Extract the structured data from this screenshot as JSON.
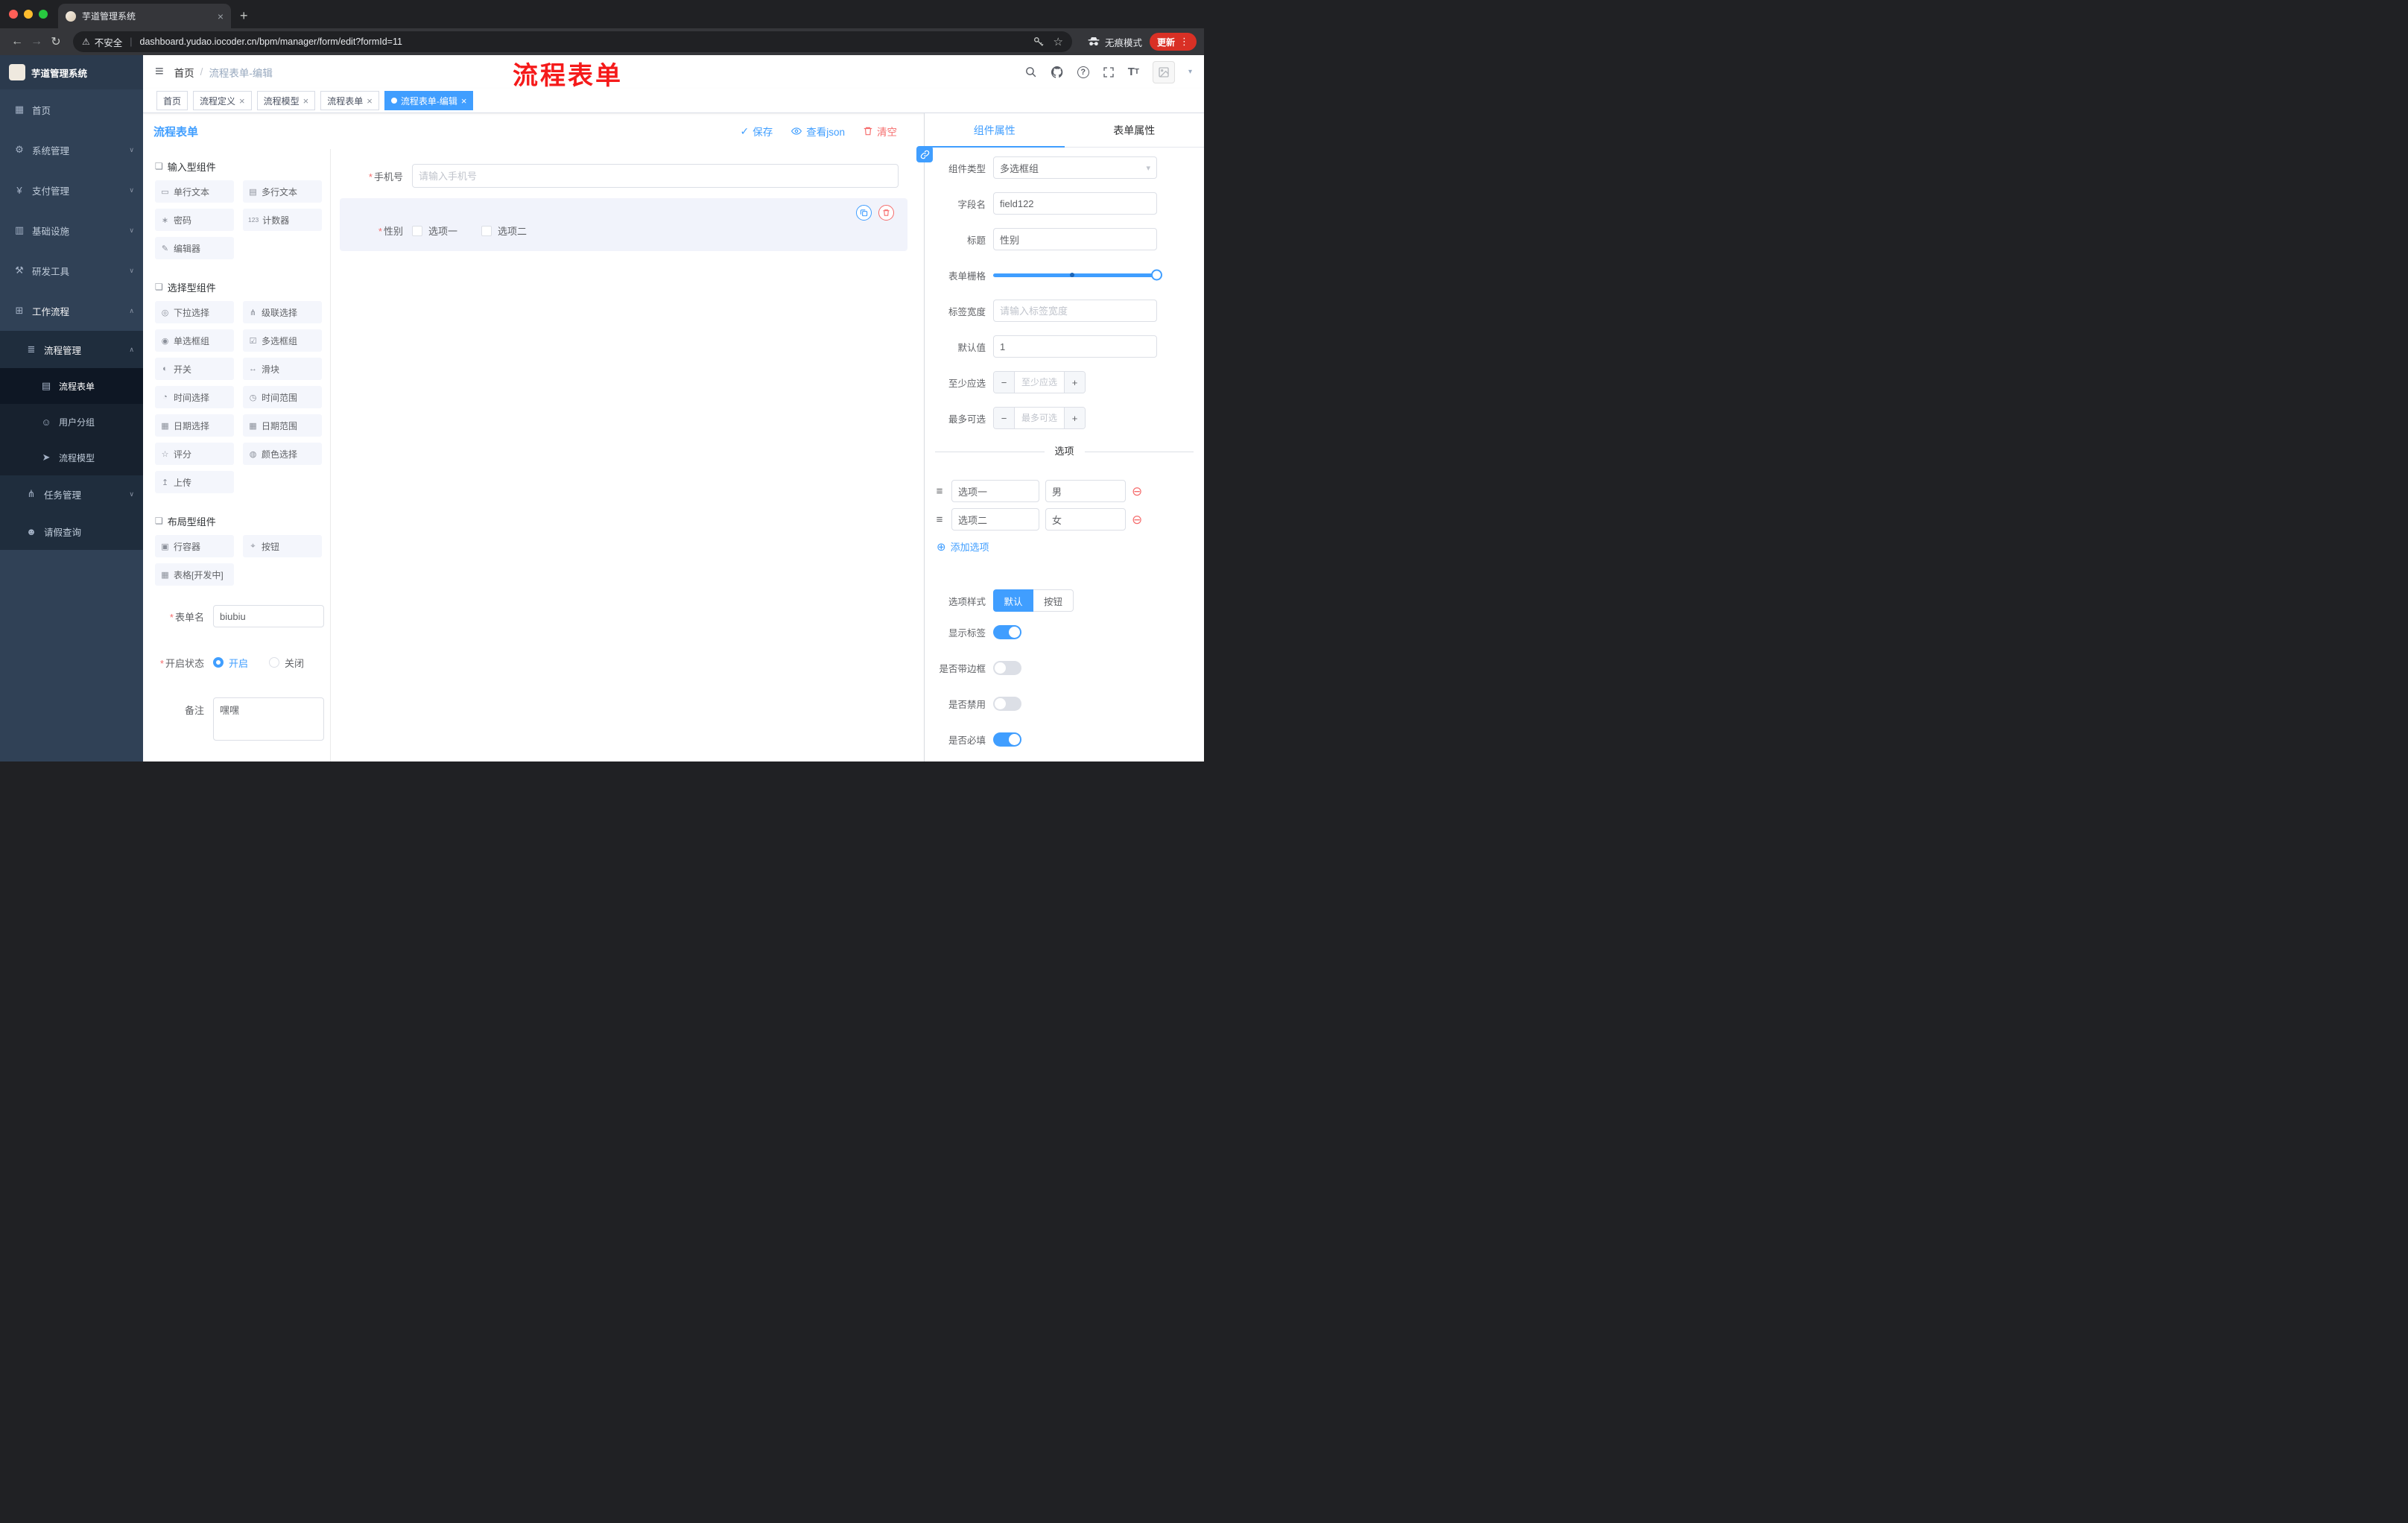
{
  "annotation": {
    "text": "流程表单"
  },
  "colors": {
    "accent": "#409eff",
    "danger": "#f56c6c",
    "sidebar": "#304156"
  },
  "browser": {
    "tab": {
      "title": "芋道管理系统"
    },
    "address": {
      "security": "不安全",
      "url": "dashboard.yudao.iocoder.cn/bpm/manager/form/edit?formId=11"
    },
    "incognito": "无痕模式",
    "update": "更新"
  },
  "sidebar": {
    "logo": "芋道管理系统",
    "menu": [
      {
        "icon": "▦",
        "label": "首页"
      },
      {
        "icon": "⚙",
        "label": "系统管理"
      },
      {
        "icon": "¥",
        "label": "支付管理"
      },
      {
        "icon": "▥",
        "label": "基础设施"
      },
      {
        "icon": "⚒",
        "label": "研发工具"
      },
      {
        "icon": "⊞",
        "label": "工作流程"
      },
      {
        "icon": "≣",
        "label": "流程管理"
      },
      {
        "icon": "▤",
        "label": "流程表单"
      },
      {
        "icon": "☺",
        "label": "用户分组"
      },
      {
        "icon": "➤",
        "label": "流程模型"
      },
      {
        "icon": "⋔",
        "label": "任务管理"
      },
      {
        "icon": "☻",
        "label": "请假查询"
      }
    ]
  },
  "header": {
    "breadcrumb": [
      "首页",
      "流程表单-编辑"
    ]
  },
  "tags": [
    {
      "label": "首页"
    },
    {
      "label": "流程定义"
    },
    {
      "label": "流程模型"
    },
    {
      "label": "流程表单"
    },
    {
      "label": "流程表单-编辑"
    }
  ],
  "designer": {
    "title": "流程表单",
    "actions": {
      "save": "保存",
      "view_json": "查看json",
      "clear": "清空"
    }
  },
  "palette": {
    "sections": [
      {
        "title": "输入型组件",
        "items": [
          {
            "g": "▭",
            "label": "单行文本"
          },
          {
            "g": "▤",
            "label": "多行文本"
          },
          {
            "g": "∗",
            "label": "密码"
          },
          {
            "g": "123",
            "label": "计数器"
          },
          {
            "g": "✎",
            "label": "编辑器"
          }
        ]
      },
      {
        "title": "选择型组件",
        "items": [
          {
            "g": "◎",
            "label": "下拉选择"
          },
          {
            "g": "⋔",
            "label": "级联选择"
          },
          {
            "g": "◉",
            "label": "单选框组"
          },
          {
            "g": "☑",
            "label": "多选框组"
          },
          {
            "g": "◐",
            "label": "开关"
          },
          {
            "g": "↔",
            "label": "滑块"
          },
          {
            "g": "◔",
            "label": "时间选择"
          },
          {
            "g": "◷",
            "label": "时间范围"
          },
          {
            "g": "▦",
            "label": "日期选择"
          },
          {
            "g": "▦",
            "label": "日期范围"
          },
          {
            "g": "☆",
            "label": "评分"
          },
          {
            "g": "◍",
            "label": "颜色选择"
          },
          {
            "g": "↥",
            "label": "上传"
          }
        ]
      },
      {
        "title": "布局型组件",
        "items": [
          {
            "g": "▣",
            "label": "行容器"
          },
          {
            "g": "⌖",
            "label": "按钮"
          },
          {
            "g": "▦",
            "label": "表格[开发中]"
          }
        ]
      }
    ],
    "form": {
      "name_label": "表单名",
      "name_value": "biubiu",
      "status_label": "开启状态",
      "status_on": "开启",
      "status_off": "关闭",
      "remark_label": "备注",
      "remark_value": "嘿嘿"
    }
  },
  "canvas": {
    "phone": {
      "label": "手机号",
      "placeholder": "请输入手机号"
    },
    "gender": {
      "label": "性别",
      "options": [
        "选项一",
        "选项二"
      ]
    }
  },
  "props": {
    "tabs": [
      "组件属性",
      "表单属性"
    ],
    "component_type": {
      "label": "组件类型",
      "value": "多选框组"
    },
    "field_name": {
      "label": "字段名",
      "value": "field122"
    },
    "title": {
      "label": "标题",
      "value": "性别"
    },
    "grid": {
      "label": "表单栅格"
    },
    "label_width": {
      "label": "标签宽度",
      "placeholder": "请输入标签宽度"
    },
    "default_value": {
      "label": "默认值",
      "value": "1"
    },
    "min_select": {
      "label": "至少应选",
      "placeholder": "至少应选"
    },
    "max_select": {
      "label": "最多可选",
      "placeholder": "最多可选"
    },
    "options_divider": "选项",
    "options": [
      {
        "label": "选项一",
        "value": "男"
      },
      {
        "label": "选项二",
        "value": "女"
      }
    ],
    "add_option": "添加选项",
    "option_style": {
      "label": "选项样式",
      "choices": [
        "默认",
        "按钮"
      ]
    },
    "switches": [
      {
        "label": "显示标签"
      },
      {
        "label": "是否带边框"
      },
      {
        "label": "是否禁用"
      },
      {
        "label": "是否必填"
      }
    ]
  }
}
